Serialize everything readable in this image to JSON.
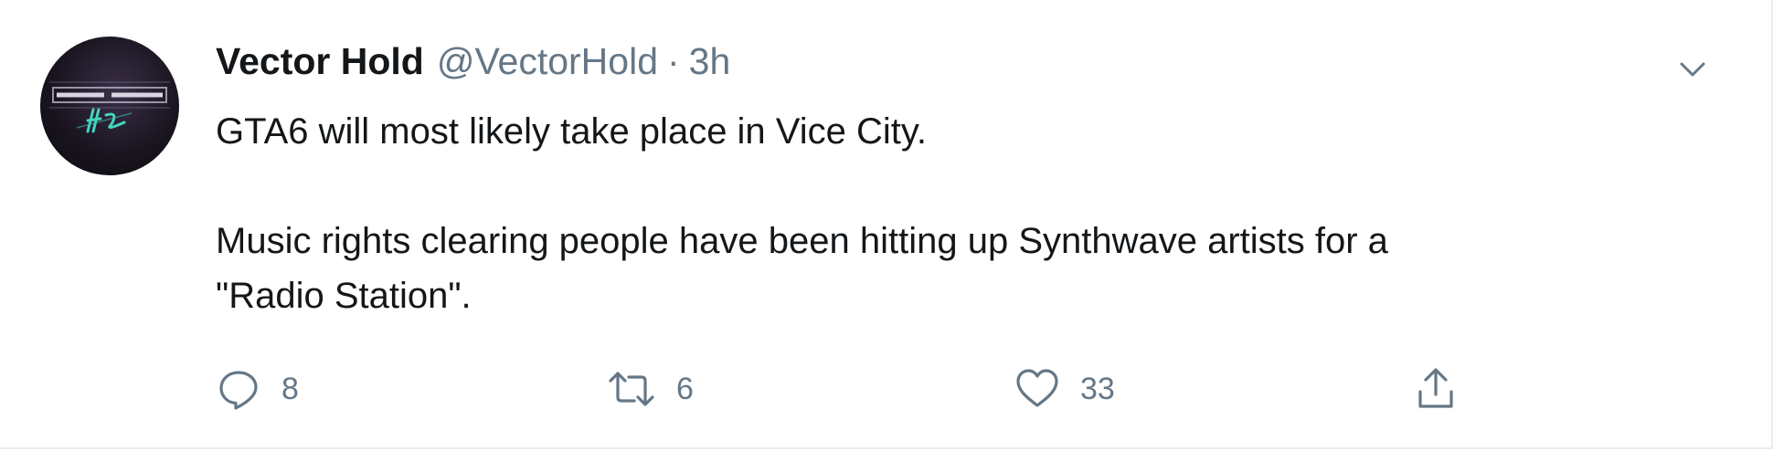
{
  "tweet": {
    "author": {
      "display_name": "Vector Hold",
      "handle": "@VectorHold",
      "separator": "·",
      "time": "3h",
      "avatar_icon": "vector-hold-logo"
    },
    "text": {
      "paragraph_1": "GTA6 will most likely take place in Vice City.",
      "paragraph_2_line_1": "Music rights clearing people have been hitting up Synthwave artists for a",
      "paragraph_2_line_2": "\"Radio Station\"."
    },
    "actions": {
      "reply": {
        "icon": "reply-icon",
        "count": "8"
      },
      "retweet": {
        "icon": "retweet-icon",
        "count": "6"
      },
      "like": {
        "icon": "heart-icon",
        "count": "33"
      },
      "share": {
        "icon": "share-icon"
      }
    },
    "menu_icon": "chevron-down-icon"
  },
  "colors": {
    "text_primary": "#14171a",
    "text_secondary": "#657786",
    "border": "#e6ecf0",
    "background": "#ffffff"
  }
}
